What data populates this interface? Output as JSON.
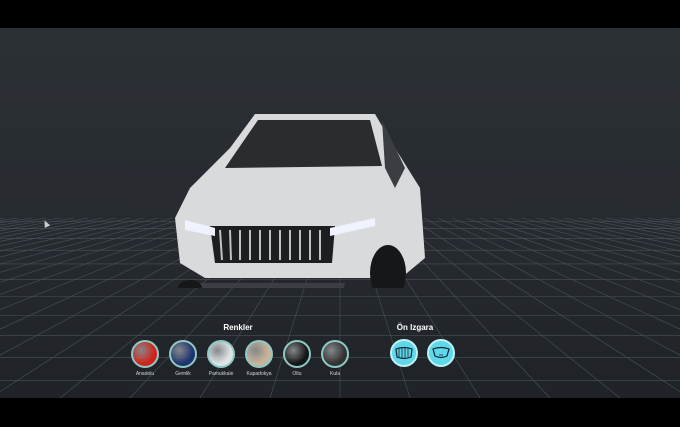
{
  "configurator": {
    "colors_title": "Renkler",
    "colors": [
      {
        "label": "Anadolu",
        "color": "#d0231c"
      },
      {
        "label": "Gemlik",
        "color": "#1f3570"
      },
      {
        "label": "Pamukkale",
        "color": "#dfe3e6"
      },
      {
        "label": "Kapadokya",
        "color": "#c9b49a"
      },
      {
        "label": "Oltu",
        "color": "#151617"
      },
      {
        "label": "Kula",
        "color": "#333333"
      }
    ],
    "grille_title": "Ön Izgara",
    "grille_options": [
      {
        "icon": "grille-pattern-icon"
      },
      {
        "icon": "grille-plain-icon"
      }
    ],
    "accent": "#5fd8ea"
  }
}
